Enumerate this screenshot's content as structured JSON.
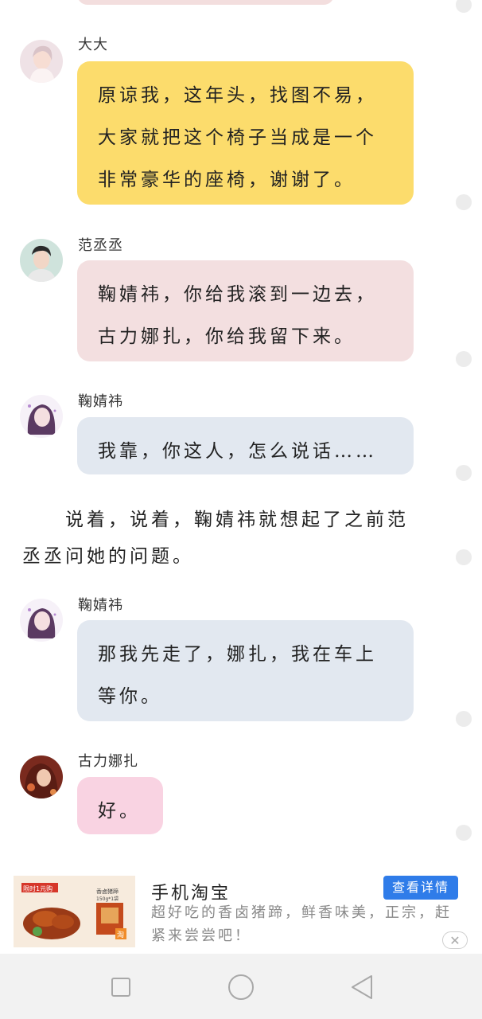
{
  "messages": [
    {
      "name": "大大",
      "text": "原谅我，这年头，找图不易，大家就把这个椅子当成是一个非常豪华的座椅，谢谢了。",
      "color": "#fcdc6c"
    },
    {
      "name": "范丞丞",
      "text": "鞠婧祎，你给我滚到一边去，古力娜扎，你给我留下来。",
      "color": "#f3dfe0"
    },
    {
      "name": "鞠婧祎",
      "text": "我靠，你这人，怎么说话……",
      "color": "#e2e8f0"
    },
    {
      "name": "鞠婧祎",
      "text": "那我先走了，娜扎，我在车上等你。",
      "color": "#e2e8f0"
    },
    {
      "name": "古力娜扎",
      "text": "好。",
      "color": "#f9d3e2"
    }
  ],
  "narration": {
    "line1": "说着，说着，鞠婧祎就想起了之前范",
    "line2": "丞丞问她的问题。"
  },
  "ad": {
    "title": "手机淘宝",
    "description": "超好吃的香卤猪蹄，鲜香味美，正宗，赶紧来尝尝吧！",
    "button": "查看详情",
    "close_icon": "close-icon",
    "image_badge": "限时1元购",
    "image_label1": "香卤猪蹄",
    "image_label2": "150g*1袋",
    "image_brand": "淘"
  },
  "navbar": {
    "recent_icon": "square-icon",
    "home_icon": "circle-icon",
    "back_icon": "triangle-back-icon"
  }
}
